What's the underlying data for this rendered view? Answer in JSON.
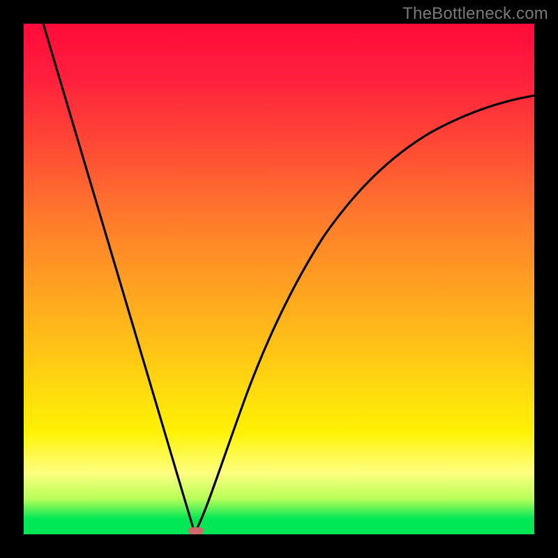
{
  "watermark": "TheBottleneck.com",
  "chart_data": {
    "type": "line",
    "title": "",
    "xlabel": "",
    "ylabel": "",
    "xlim": [
      0,
      1
    ],
    "ylim": [
      0,
      1
    ],
    "grid": false,
    "legend": false,
    "series": [
      {
        "name": "left-branch",
        "x": [
          0.038,
          0.335
        ],
        "y": [
          1.0,
          0.003
        ],
        "notes": "near-straight descending segment from top-left to trough"
      },
      {
        "name": "right-branch",
        "x": [
          0.335,
          0.4,
          0.45,
          0.5,
          0.55,
          0.6,
          0.65,
          0.7,
          0.75,
          0.8,
          0.85,
          0.9,
          0.95,
          1.0
        ],
        "y": [
          0.003,
          0.18,
          0.31,
          0.42,
          0.51,
          0.585,
          0.645,
          0.695,
          0.735,
          0.77,
          0.795,
          0.815,
          0.83,
          0.845
        ],
        "notes": "concave curve rising from trough toward upper-right; flattens near right edge"
      }
    ],
    "trough": {
      "x": 0.335,
      "y": 0.003
    },
    "background_gradient": {
      "orientation": "vertical",
      "stops": [
        {
          "pos": 0.0,
          "color": "#ff0b3a"
        },
        {
          "pos": 0.38,
          "color": "#ff7a2c"
        },
        {
          "pos": 0.66,
          "color": "#ffca14"
        },
        {
          "pos": 0.88,
          "color": "#feff80"
        },
        {
          "pos": 0.97,
          "color": "#00e756"
        }
      ]
    },
    "marker": {
      "color": "#cf6a6a",
      "shape": "rounded-rect",
      "x": 0.335,
      "y": 0.003
    }
  },
  "colors": {
    "frame": "#000000",
    "curve": "#000000",
    "watermark": "#7a7a7a",
    "marker": "#cf6a6a"
  }
}
